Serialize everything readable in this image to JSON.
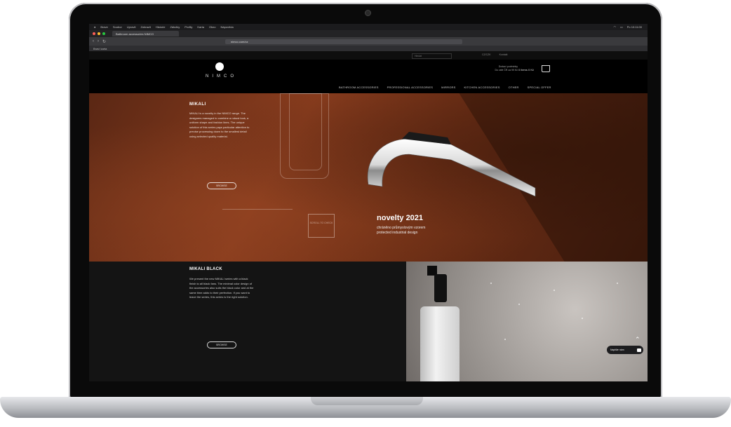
{
  "menubar": {
    "items": [
      "Brave",
      "Soubor",
      "Upravit",
      "Zobrazit",
      "Historie",
      "Záložky",
      "Profily",
      "Karta",
      "Okno",
      "Nápověda"
    ],
    "status": "Po 10:11:00"
  },
  "browser": {
    "tab_title": "Bathroom accessories NIMCO",
    "url": "nimco.com/cz",
    "bookmark": "Braví karta"
  },
  "site": {
    "search_placeholder": "Hledat",
    "top_links": [
      "CZ/CZK",
      "Kontakt"
    ],
    "logo_text": "NIMCO",
    "cart_note_1": "Dodací podmínky",
    "cart_note_2": "Do celé ČR za 99 Kč",
    "cart_total": "0 items 0 Kč",
    "nav": [
      "BATHROOM ACCESSORIES",
      "PROFESSIONAL ACCESSORIES",
      "MIRRORS",
      "KITCHEN ACCESSORIES",
      "OTHER",
      "SPECIAL OFFER"
    ]
  },
  "hero": {
    "title": "MIKALI",
    "desc": "MIKALI is a novelty in the NIMCO range. The designers managed to combine a robust look, a uniform shape and fashion lines. The unique solution of this series pays particular attention to precise processing down to the smallest detail using selected quality material.",
    "button": "BROWSE",
    "scroll": "SCROLL TO CHECK",
    "novelty_title": "novelty 2021",
    "novelty_line1": "chráněno průmyslovým vzorem",
    "novelty_line2": "protected industrial design"
  },
  "black": {
    "title": "MIKALI BLACK",
    "desc": "We present the new MIKALI series with a black finish to all black fans. The minimal color design of the accessories also suits the black color and at the same time adds to their perfection. If you want to leave the series, this series is the right solution.",
    "button": "BROWSE"
  },
  "chat": {
    "label": "Napište nám"
  },
  "colors": {
    "accent_rust": "#8a3d1e",
    "background": "#000000"
  }
}
